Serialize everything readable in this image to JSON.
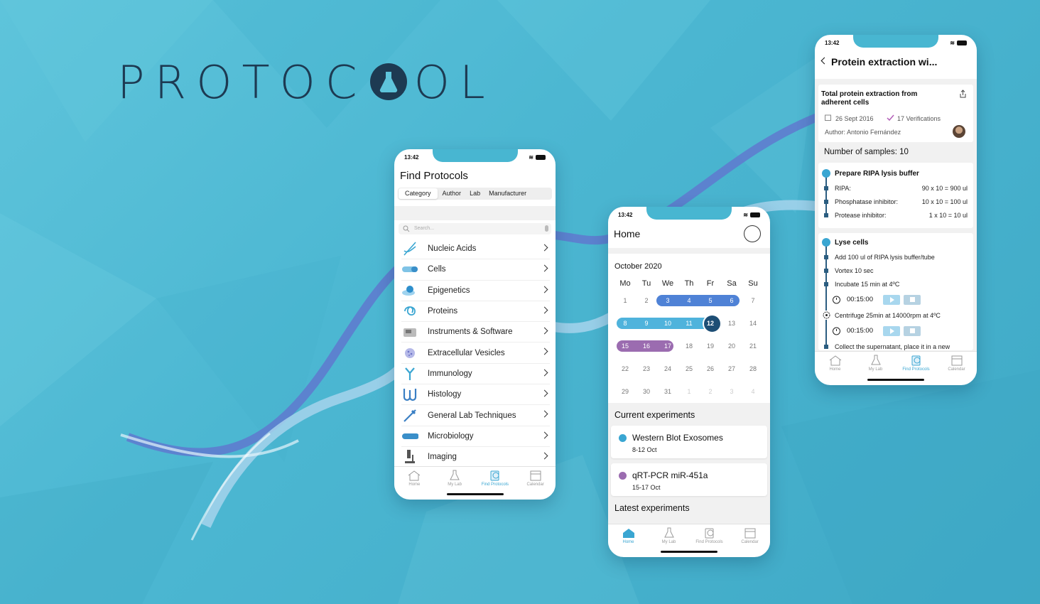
{
  "brand": {
    "logo_text_left": "PROTOC",
    "logo_text_right": "OL"
  },
  "colors": {
    "accent": "#3aa6d2",
    "navy": "#1d4e75",
    "purple": "#9b6cb0",
    "blue_band": "#4f82d6",
    "cyan_band": "#4fb3dc"
  },
  "tabbar": {
    "home": "Home",
    "my_lab": "My Lab",
    "find": "Find Protocols",
    "calendar": "Calendar"
  },
  "find_protocols": {
    "time": "13:42",
    "title": "Find Protocols",
    "segments": [
      "Category",
      "Author",
      "Lab",
      "Manufacturer"
    ],
    "search_placeholder": "Search...",
    "categories": [
      {
        "label": "Nucleic Acids",
        "icon": "dna-icon"
      },
      {
        "label": "Cells",
        "icon": "cell-icon"
      },
      {
        "label": "Epigenetics",
        "icon": "epigenetics-icon"
      },
      {
        "label": "Proteins",
        "icon": "protein-icon"
      },
      {
        "label": "Instruments & Software",
        "icon": "instrument-icon"
      },
      {
        "label": "Extracellular Vesicles",
        "icon": "vesicle-icon"
      },
      {
        "label": "Immunology",
        "icon": "antibody-icon"
      },
      {
        "label": "Histology",
        "icon": "histology-icon"
      },
      {
        "label": "General Lab Techniques",
        "icon": "pipette-icon"
      },
      {
        "label": "Microbiology",
        "icon": "bacteria-icon"
      },
      {
        "label": "Imaging",
        "icon": "microscope-icon"
      }
    ]
  },
  "home": {
    "time": "13:42",
    "title": "Home",
    "month": "October 2020",
    "weekdays": [
      "Mo",
      "Tu",
      "We",
      "Th",
      "Fr",
      "Sa",
      "Su"
    ],
    "weeks": [
      [
        "1",
        "2",
        "3",
        "4",
        "5",
        "6",
        "7"
      ],
      [
        "8",
        "9",
        "10",
        "11",
        "12",
        "13",
        "14"
      ],
      [
        "15",
        "16",
        "17",
        "18",
        "19",
        "20",
        "21"
      ],
      [
        "22",
        "23",
        "24",
        "25",
        "26",
        "27",
        "28"
      ],
      [
        "29",
        "30",
        "31",
        "1",
        "2",
        "3",
        "4"
      ]
    ],
    "current_title": "Current experiments",
    "experiments": [
      {
        "name": "Western Blot Exosomes",
        "date": "8-12 Oct",
        "color": "#3aa6d2"
      },
      {
        "name": "qRT-PCR miR-451a",
        "date": "15-17 Oct",
        "color": "#9b6cb0"
      }
    ],
    "latest_title": "Latest experiments"
  },
  "protocol": {
    "time": "13:42",
    "title": "Protein extraction wi...",
    "heading": "Total protein extraction from adherent cells",
    "date": "26 Sept 2016",
    "verifications": "17 Verifications",
    "author": "Author: Antonio Fernández",
    "samples": "Number of samples: 10",
    "step1": {
      "title": "Prepare RIPA lysis buffer",
      "lines": [
        {
          "label": "RIPA:",
          "value": "90 x 10 = 900 ul"
        },
        {
          "label": "Phosphatase inhibitor:",
          "value": "10 x 10 = 100 ul"
        },
        {
          "label": "Protease inhibitor:",
          "value": "1 x 10 =  10 ul"
        }
      ]
    },
    "step2": {
      "title": "Lyse cells",
      "lines": [
        "Add 100 ul of RIPA lysis buffer/tube",
        "Vortex 10 sec",
        "Incubate 15 min at 4ºC"
      ],
      "timer1": "00:15:00",
      "centrifuge": "Centrifuge 25min at 14000rpm at 4ºC",
      "timer2": "00:15:00",
      "last": "Collect the supernatant, place it in a new"
    }
  }
}
